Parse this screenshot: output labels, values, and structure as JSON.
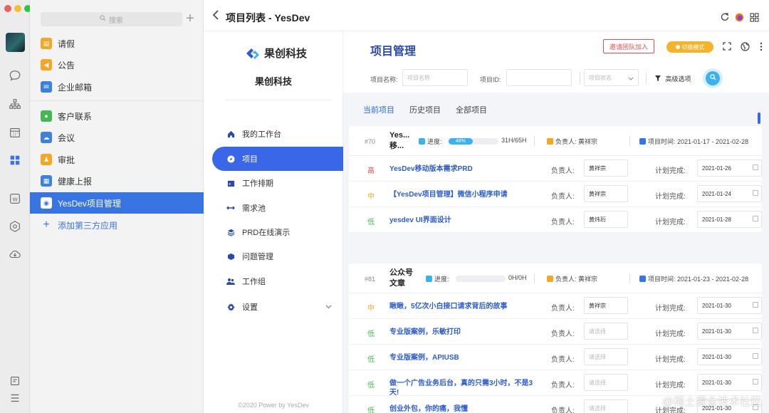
{
  "window": {
    "traffic_lights": [
      "#ee5f57",
      "#f6be2f",
      "#29c840"
    ]
  },
  "rail": {
    "icons": [
      "avatar",
      "chat-icon",
      "org-chart-icon",
      "calendar-icon",
      "apps-grid-icon",
      "word-doc-icon",
      "cube-icon",
      "cloud-icon",
      "mail-icon",
      "menu-icon"
    ]
  },
  "applist": {
    "search_placeholder": "搜索",
    "plus_label": "+",
    "items": [
      {
        "label": "请假",
        "color": "#f5a623",
        "icon": "leave-icon"
      },
      {
        "label": "公告",
        "color": "#f5a623",
        "icon": "megaphone-icon"
      },
      {
        "label": "企业邮箱",
        "color": "#3b82e0",
        "icon": "mail-icon"
      },
      {
        "label": "客户联系",
        "color": "#3fb950",
        "icon": "chat-bubble-icon"
      },
      {
        "label": "会议",
        "color": "#3b82e0",
        "icon": "meeting-cloud-icon"
      },
      {
        "label": "审批",
        "color": "#f5a623",
        "icon": "approval-icon"
      },
      {
        "label": "健康上报",
        "color": "#3b82e0",
        "icon": "health-grid-icon"
      },
      {
        "label": "YesDev项目管理",
        "color": "#ffffff",
        "icon": "yesdev-logo-icon"
      }
    ],
    "add_label": "添加第三方应用"
  },
  "topbar": {
    "title": "项目列表 - YesDev",
    "back_icon": "chevron-left-icon",
    "right_icons": [
      "refresh-icon",
      "firefox-icon",
      "grid-icon"
    ]
  },
  "navpanel": {
    "logo_text": "果创科技",
    "company": "果创科技",
    "items": [
      {
        "label": "我的工作台",
        "icon": "home-icon"
      },
      {
        "label": "项目",
        "icon": "compass-icon",
        "active": true
      },
      {
        "label": "工作排期",
        "icon": "calendar-icon"
      },
      {
        "label": "需求池",
        "icon": "arrows-icon"
      },
      {
        "label": "PRD在线演示",
        "icon": "layers-icon"
      },
      {
        "label": "问题管理",
        "icon": "cube-icon"
      },
      {
        "label": "工作组",
        "icon": "group-icon"
      },
      {
        "label": "设置",
        "icon": "settings-icon"
      }
    ],
    "footer": "©2020 Power by YesDev"
  },
  "main": {
    "title": "项目管理",
    "invite_label": "邀请团队加入",
    "switch_label": "切换模式",
    "icons": [
      "fullscreen-icon",
      "globe-icon",
      "more-icon"
    ],
    "filters": {
      "name_label": "项目名称:",
      "name_placeholder": "项目名称",
      "id_label": "项目ID:",
      "status_placeholder": "项目状态",
      "advanced_label": "高级选项"
    },
    "tabs": [
      "当前项目",
      "历史项目",
      "全部项目"
    ],
    "projects": [
      {
        "id": "#70",
        "title": "Yes...移...",
        "progress_label": "进度:",
        "progress_percent": 48,
        "progress_text": "48%",
        "hours": "31H/65H",
        "owner": "负责人: 黄祥宗",
        "time": "项目时间: 2021-01-17 - 2021-02-28",
        "tasks": [
          {
            "prio": "高",
            "prio_color": "#e04848",
            "name": "YesDev移动版本需求PRD",
            "owner_label": "负责人:",
            "owner": "黄祥宗",
            "plan_label": "计划完成:",
            "date": "2021-01-26"
          },
          {
            "prio": "中",
            "prio_color": "#f5a623",
            "name": "【YesDev项目管理】微信小程序申请",
            "owner_label": "负责人:",
            "owner": "黄祥宗",
            "plan_label": "计划完成:",
            "date": "2021-01-24"
          },
          {
            "prio": "低",
            "prio_color": "#3fb950",
            "name": "yesdev UI界面设计",
            "owner_label": "负责人:",
            "owner": "黄炜珩",
            "plan_label": "计划完成:",
            "date": "2021-01-28"
          }
        ]
      },
      {
        "id": "#81",
        "title": "公众号文章",
        "progress_label": "进度:",
        "progress_percent": 0,
        "progress_text": "",
        "hours": "0H/0H",
        "owner": "负责人: 黄祥宗",
        "time": "项目时间: 2021-01-23 - 2021-02-28",
        "tasks": [
          {
            "prio": "中",
            "prio_color": "#f5a623",
            "name": "瞅瞅，5亿次小白接口请求背后的故事",
            "owner_label": "负责人:",
            "owner": "黄祥宗",
            "plan_label": "计划完成:",
            "date": "2021-01-30"
          },
          {
            "prio": "低",
            "prio_color": "#3fb950",
            "name": "专业版案例，乐敏打印",
            "owner_label": "负责人:",
            "owner": "请选择",
            "plan_label": "计划完成:",
            "date": "2021-01-30"
          },
          {
            "prio": "低",
            "prio_color": "#3fb950",
            "name": "专业版案例，APIUSB",
            "owner_label": "负责人:",
            "owner": "请选择",
            "plan_label": "计划完成:",
            "date": "2021-01-30"
          },
          {
            "prio": "低",
            "prio_color": "#3fb950",
            "name": "做一个广告业务后台，真的只需3小时，不是3天!",
            "owner_label": "负责人:",
            "owner": "请选择",
            "plan_label": "计划完成:",
            "date": "2021-01-30"
          },
          {
            "prio": "低",
            "prio_color": "#3fb950",
            "name": "创业外包，你的痛，我懂",
            "owner_label": "负责人:",
            "owner": "请选择",
            "plan_label": "计划完成:",
            "date": "2021-01-30"
          }
        ]
      }
    ]
  },
  "watermark": "@稀土掘金技术社区"
}
